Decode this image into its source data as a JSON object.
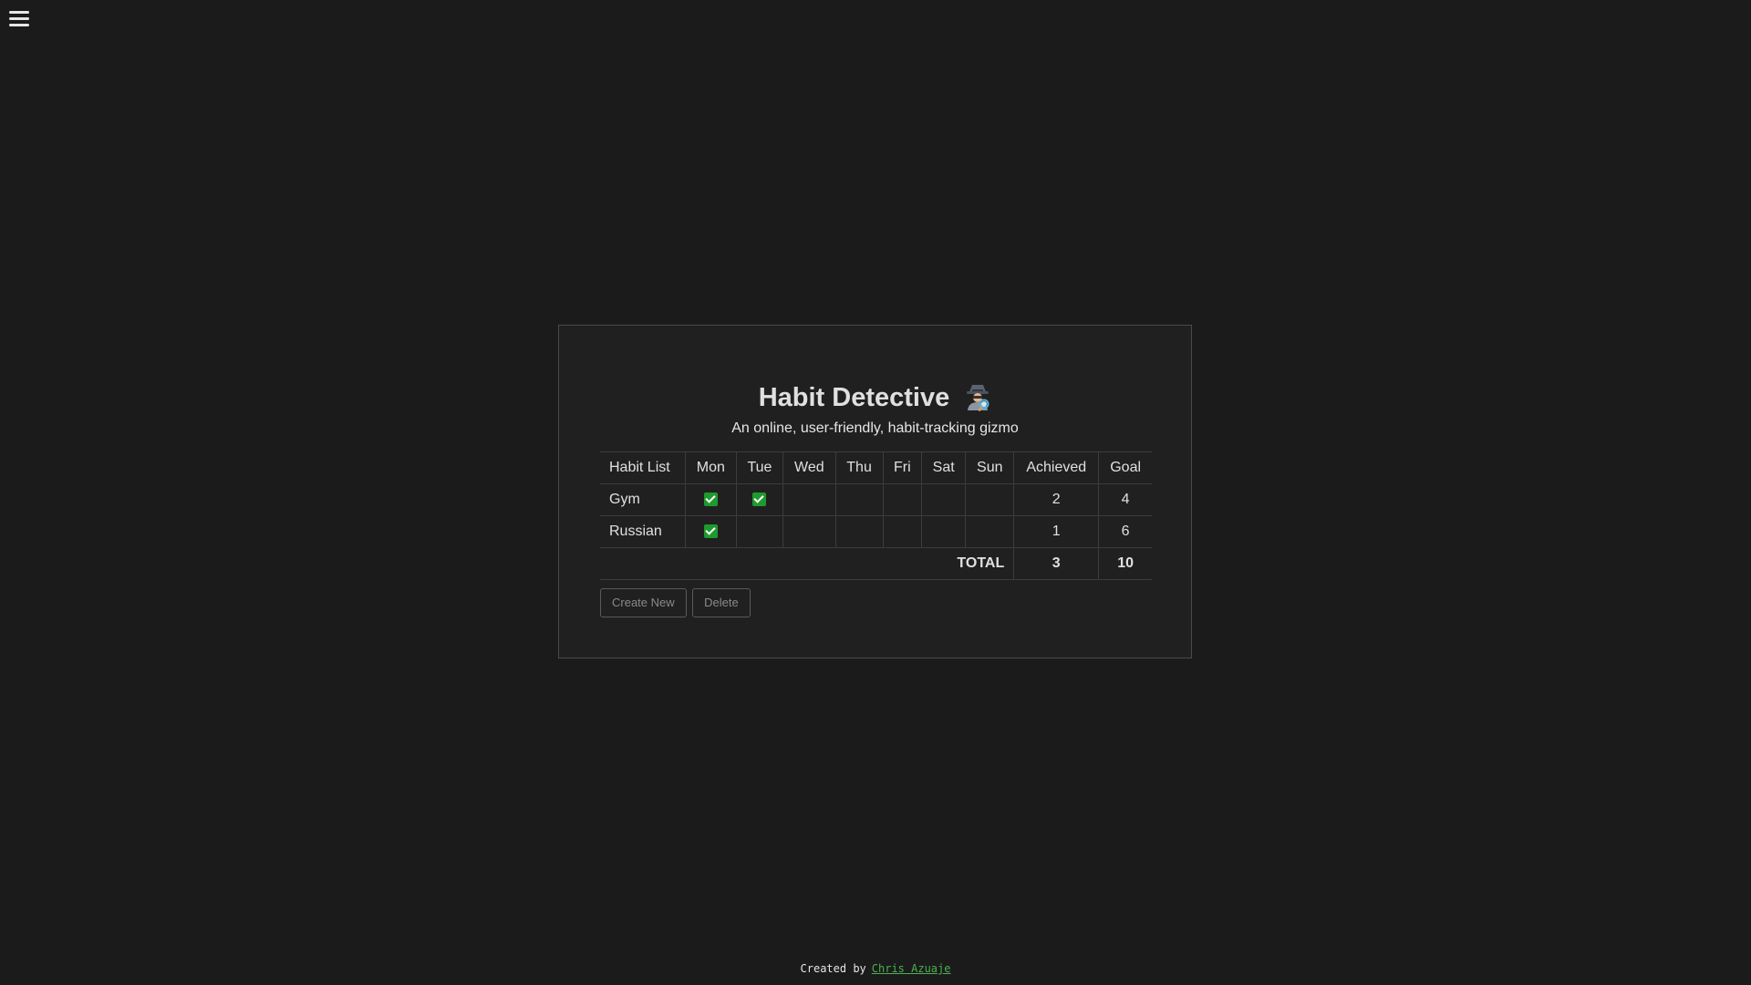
{
  "menu": {
    "icon": "hamburger-menu-icon"
  },
  "header": {
    "title": "Habit Detective",
    "title_icon": "detective-icon",
    "subtitle": "An online, user-friendly, habit-tracking gizmo"
  },
  "table": {
    "columns": [
      "Habit List",
      "Mon",
      "Tue",
      "Wed",
      "Thu",
      "Fri",
      "Sat",
      "Sun",
      "Achieved",
      "Goal"
    ],
    "rows": [
      {
        "habit": "Gym",
        "days": [
          true,
          true,
          false,
          false,
          false,
          false,
          false
        ],
        "achieved": "2",
        "goal": "4"
      },
      {
        "habit": "Russian",
        "days": [
          true,
          false,
          false,
          false,
          false,
          false,
          false
        ],
        "achieved": "1",
        "goal": "6"
      }
    ],
    "total": {
      "label": "TOTAL",
      "achieved": "3",
      "goal": "10"
    },
    "check_color": "#1f9a2e"
  },
  "actions": {
    "create_label": "Create New",
    "delete_label": "Delete"
  },
  "footer": {
    "prefix": "Created by",
    "author": "Chris Azuaje",
    "link_color": "#4caf50"
  }
}
